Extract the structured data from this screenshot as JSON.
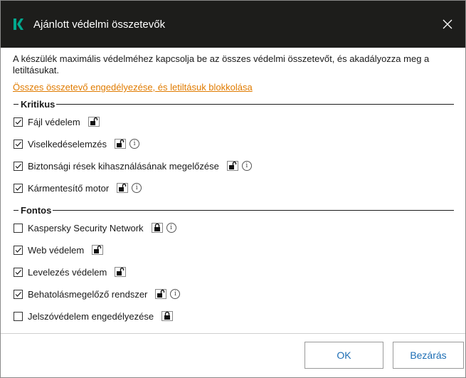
{
  "window": {
    "title": "Ajánlott védelmi összetevők",
    "description": "A készülék maximális védelméhez kapcsolja be az összes védelmi összetevőt, és akadályozza meg a letiltásukat.",
    "enable_all_link": "Összes összetevő engedélyezése, és letiltásuk blokkolása"
  },
  "groups": [
    {
      "title": "Kritikus",
      "items": [
        {
          "label": "Fájl védelem",
          "checked": true,
          "lock": "open",
          "info": false
        },
        {
          "label": "Viselkedéselemzés",
          "checked": true,
          "lock": "open",
          "info": true
        },
        {
          "label": "Biztonsági rések kihasználásának megelőzése",
          "checked": true,
          "lock": "open",
          "info": true
        },
        {
          "label": "Kármentesítő motor",
          "checked": true,
          "lock": "open",
          "info": true
        }
      ]
    },
    {
      "title": "Fontos",
      "items": [
        {
          "label": "Kaspersky Security Network",
          "checked": false,
          "lock": "closed",
          "info": true
        },
        {
          "label": "Web védelem",
          "checked": true,
          "lock": "open",
          "info": false
        },
        {
          "label": "Levelezés védelem",
          "checked": true,
          "lock": "open",
          "info": false
        },
        {
          "label": "Behatolásmegelőző rendszer",
          "checked": true,
          "lock": "open",
          "info": true
        },
        {
          "label": "Jelszóvédelem engedélyezése",
          "checked": false,
          "lock": "closed",
          "info": false
        }
      ]
    }
  ],
  "buttons": {
    "ok": "OK",
    "close": "Bezárás"
  },
  "colors": {
    "titlebar": "#1d1d1b",
    "logo": "#00a88e",
    "link": "#e07b00",
    "button_text": "#1d6eb5"
  }
}
